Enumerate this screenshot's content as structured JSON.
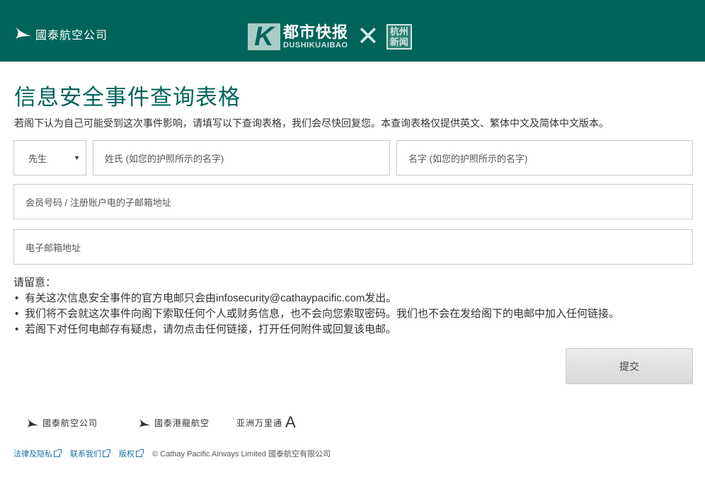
{
  "header": {
    "brand_logo_text": "國泰航空公司",
    "partner_cn": "都市快报",
    "partner_en": "DUSHIKUAIBAO",
    "partner2": "杭州新闻",
    "cross": "✕",
    "bg_color": "#00645a"
  },
  "title": "信息安全事件查询表格",
  "intro": "若阁下认为自己可能受到这次事件影响，请填写以下查询表格，我们会尽快回复您。本查询表格仅提供英文、繁体中文及简体中文版本。",
  "form": {
    "title_select": {
      "value": "先生",
      "caret": "▼"
    },
    "surname_placeholder": "姓氏 (如您的护照所示的名字)",
    "given_name_placeholder": "名字 (如您的护照所示的名字)",
    "member_placeholder": "会员号码 / 注册账户电的子邮箱地址",
    "email_placeholder": "电子邮箱地址"
  },
  "notice": {
    "heading": "请留意：",
    "bullet": "•",
    "items": [
      "有关这次信息安全事件的官方电邮只会由infosecurity@cathaypacific.com发出。",
      "我们将不会就这次事件向阁下索取任何个人或财务信息，也不会向您索取密码。我们也不会在发给阁下的电邮中加入任何链接。",
      "若阁下对任何电邮存有疑虑，请勿点击任何链接，打开任何附件或回复该电邮。"
    ]
  },
  "submit_label": "提交",
  "footer": {
    "logos": [
      "國泰航空公司",
      "國泰港龍航空",
      "亚洲万里通"
    ],
    "asia_mark": "A",
    "links": [
      "法律及隐私",
      "联系我们",
      "版权"
    ],
    "copyright": "© Cathay Pacific Airways Limited 國泰航空有限公司"
  }
}
